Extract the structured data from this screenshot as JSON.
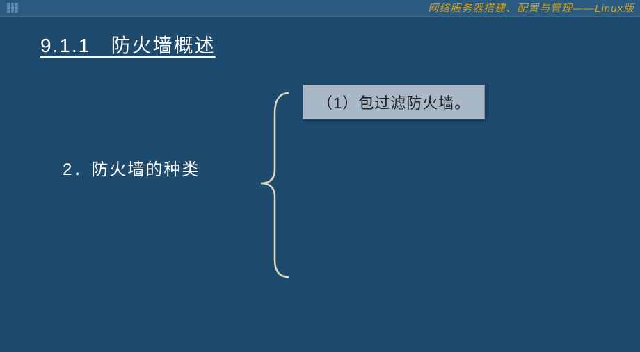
{
  "header": {
    "title_prefix": "网络服务器搭建、配置与管理",
    "title_separator": "——",
    "title_suffix": "Linux版"
  },
  "slide": {
    "section_number": "9.1.1",
    "section_title": "防火墙概述",
    "subtitle_number": "2．",
    "subtitle_text": "防火墙的种类",
    "callout_number": "（1）",
    "callout_text": "包过滤防火墙。"
  }
}
